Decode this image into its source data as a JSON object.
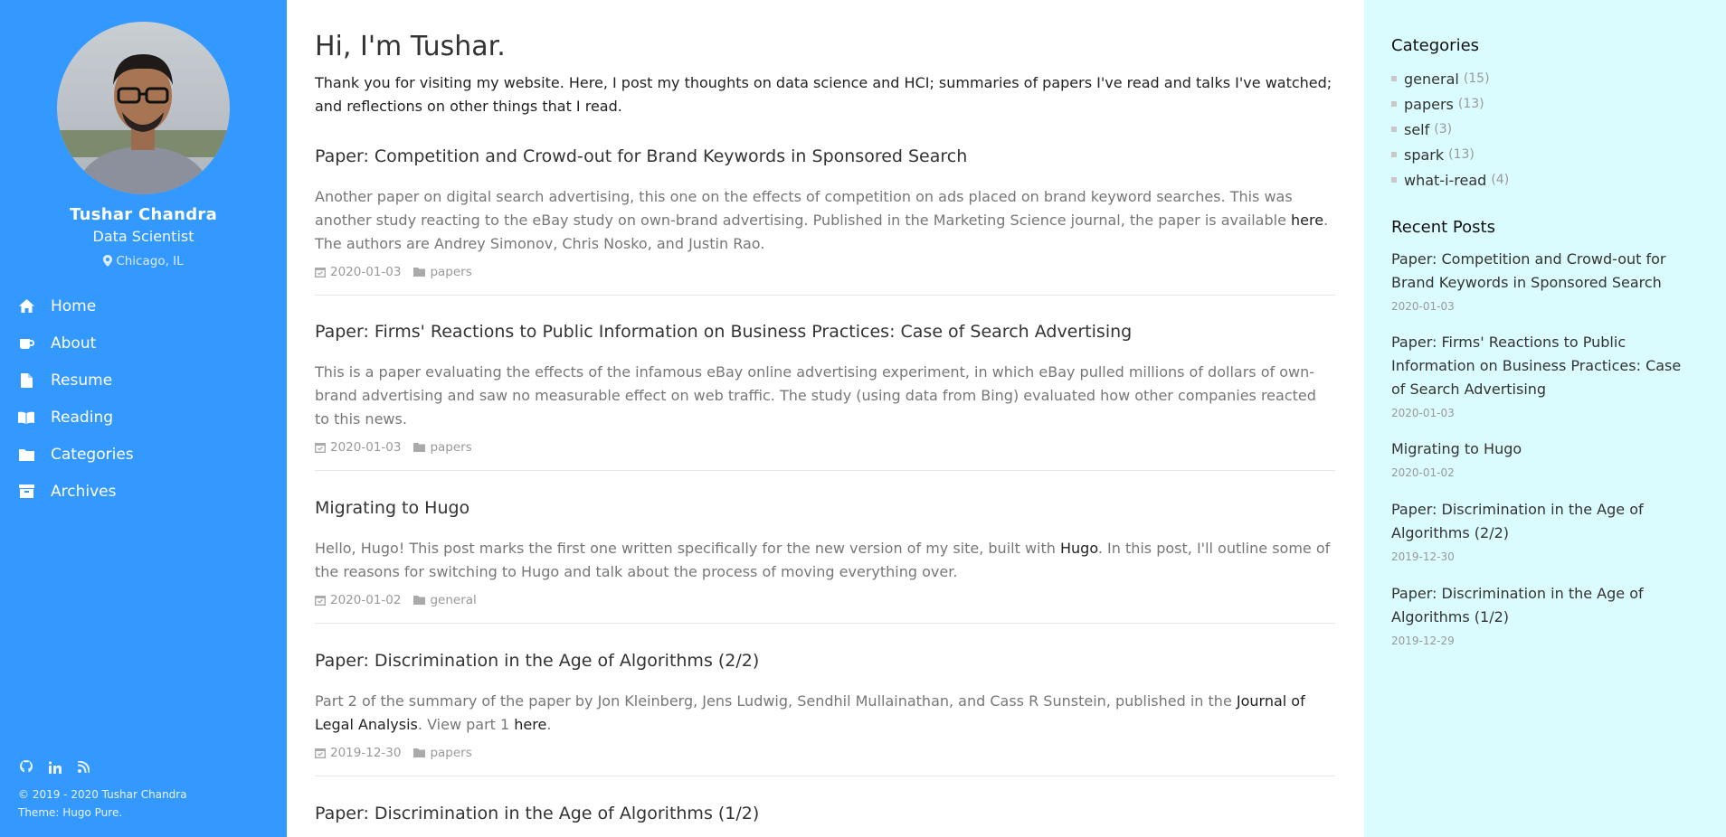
{
  "profile": {
    "name": "Tushar Chandra",
    "job": "Data Scientist",
    "location": "Chicago, IL"
  },
  "nav": [
    {
      "label": "Home",
      "icon": "home-icon"
    },
    {
      "label": "About",
      "icon": "coffee-icon"
    },
    {
      "label": "Resume",
      "icon": "file-icon"
    },
    {
      "label": "Reading",
      "icon": "book-icon"
    },
    {
      "label": "Categories",
      "icon": "folder-icon"
    },
    {
      "label": "Archives",
      "icon": "archive-icon"
    }
  ],
  "social": [
    "github-icon",
    "linkedin-icon",
    "rss-icon"
  ],
  "footer": {
    "copyright": "© 2019 - 2020 Tushar Chandra",
    "theme": "Theme: Hugo Pure."
  },
  "main": {
    "title": "Hi, I'm Tushar.",
    "intro": "Thank you for visiting my website. Here, I post my thoughts on data science and HCI; summaries of papers I've read and talks I've watched; and reflections on other things that I read.",
    "posts": [
      {
        "title": "Paper: Competition and Crowd-out for Brand Keywords in Sponsored Search",
        "sum_a": "Another paper on digital search advertising, this one on the effects of competition on ads placed on brand keyword searches. This was another study reacting to the eBay study on own-brand advertising. Published in the Marketing Science journal, the paper is available ",
        "link1": "here",
        "sum_b": ". The authors are Andrey Simonov, Chris Nosko, and Justin Rao.",
        "date": "2020-01-03",
        "category": "papers"
      },
      {
        "title": "Paper: Firms' Reactions to Public Information on Business Practices: Case of Search Advertising",
        "sum_a": "This is a paper evaluating the effects of the infamous eBay online advertising experiment, in which eBay pulled millions of dollars of own-brand advertising and saw no measurable effect on web traffic. The study (using data from Bing) evaluated how other companies reacted to this news.",
        "date": "2020-01-03",
        "category": "papers"
      },
      {
        "title": "Migrating to Hugo",
        "sum_a": "Hello, Hugo! This post marks the first one written specifically for the new version of my site, built with ",
        "link1": "Hugo",
        "sum_b": ". In this post, I'll outline some of the reasons for switching to Hugo and talk about the process of moving everything over.",
        "date": "2020-01-02",
        "category": "general"
      },
      {
        "title": "Paper: Discrimination in the Age of Algorithms (2/2)",
        "sum_a": "Part 2 of the summary of the paper by Jon Kleinberg, Jens Ludwig, Sendhil Mullainathan, and Cass R Sunstein, published in the ",
        "link1": "Journal of Legal Analysis",
        "sum_b": ". View part 1 ",
        "link2": "here",
        "sum_c": ".",
        "date": "2019-12-30",
        "category": "papers"
      },
      {
        "title": "Paper: Discrimination in the Age of Algorithms (1/2)"
      }
    ]
  },
  "right": {
    "categories_heading": "Categories",
    "categories": [
      {
        "name": "general",
        "count": "(15)"
      },
      {
        "name": "papers",
        "count": "(13)"
      },
      {
        "name": "self",
        "count": "(3)"
      },
      {
        "name": "spark",
        "count": "(13)"
      },
      {
        "name": "what-i-read",
        "count": "(4)"
      }
    ],
    "recent_heading": "Recent Posts",
    "recent": [
      {
        "title": "Paper: Competition and Crowd-out for Brand Keywords in Sponsored Search",
        "date": "2020-01-03"
      },
      {
        "title": "Paper: Firms' Reactions to Public Information on Business Practices: Case of Search Advertising",
        "date": "2020-01-03"
      },
      {
        "title": "Migrating to Hugo",
        "date": "2020-01-02"
      },
      {
        "title": "Paper: Discrimination in the Age of Algorithms (2/2)",
        "date": "2019-12-30"
      },
      {
        "title": "Paper: Discrimination in the Age of Algorithms (1/2)",
        "date": "2019-12-29"
      }
    ]
  },
  "colors": {
    "sidebar": "#3399ff",
    "right_panel": "#dafcff",
    "summary_text": "#777777",
    "meta_text": "#999999"
  }
}
